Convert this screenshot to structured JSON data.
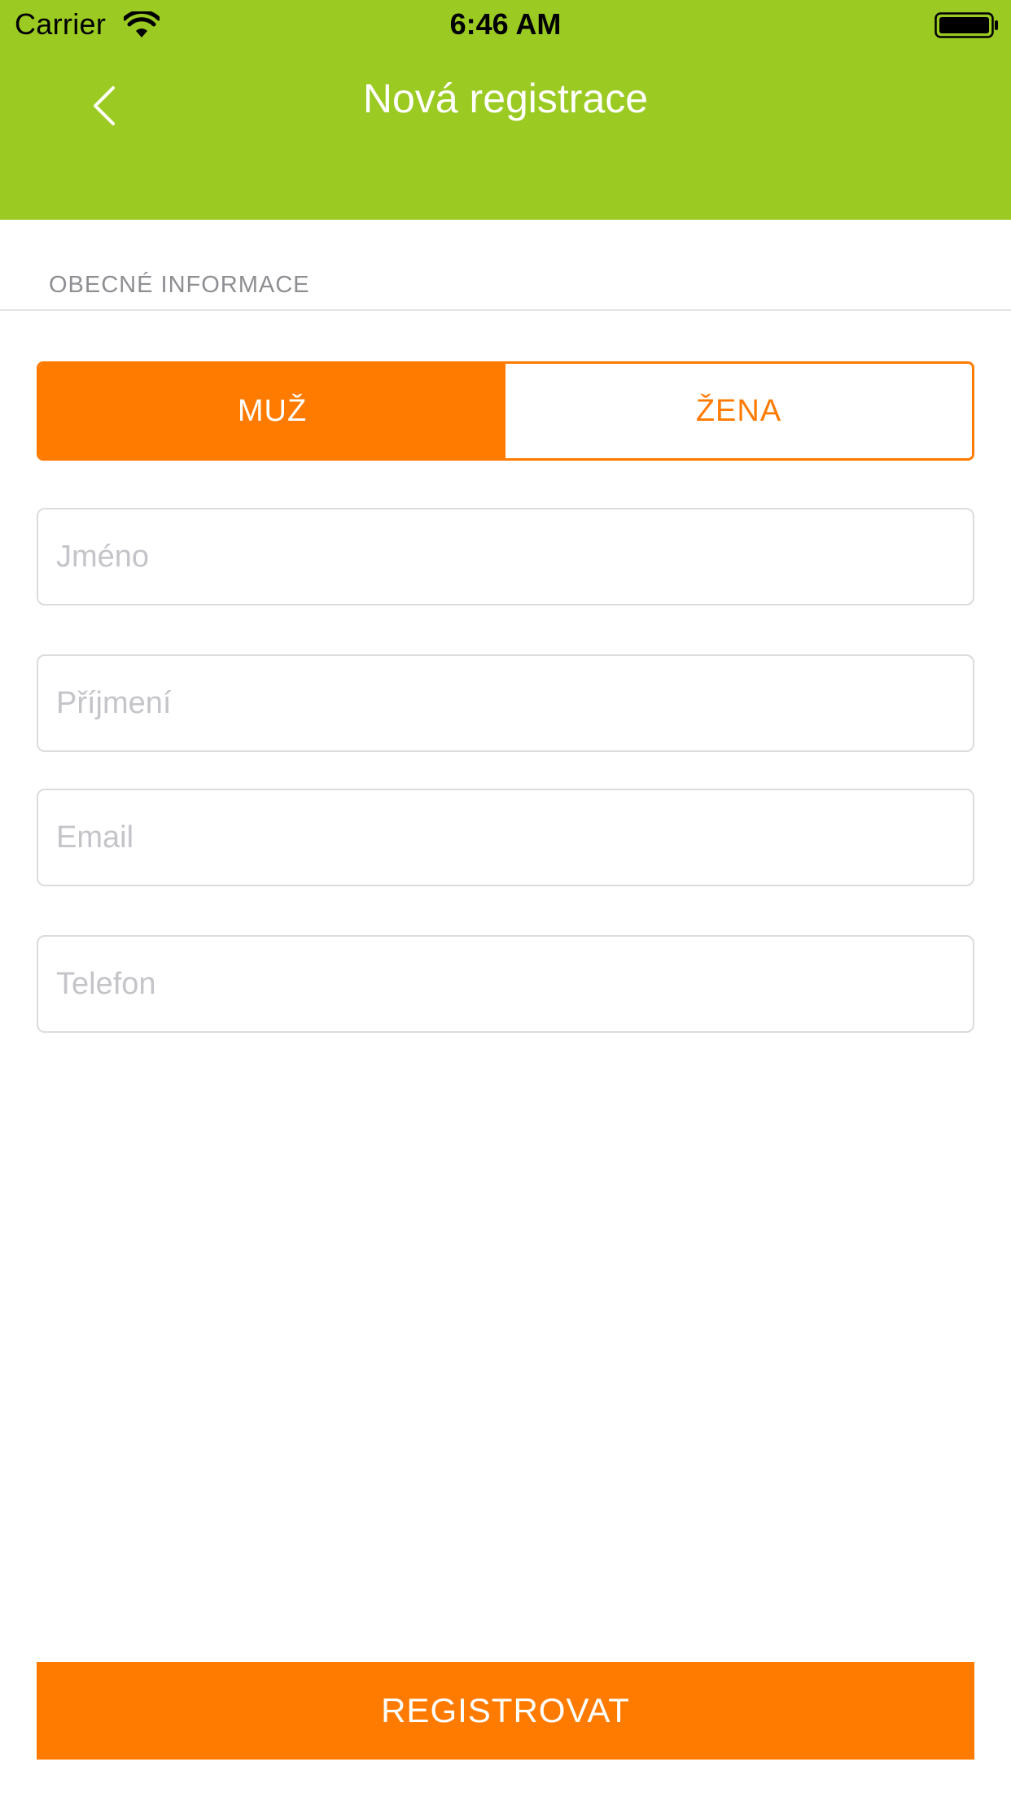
{
  "status_bar": {
    "carrier": "Carrier",
    "time": "6:46 AM"
  },
  "nav": {
    "title": "Nová registrace",
    "back_icon": "chevron-left-icon"
  },
  "section": {
    "title": "OBECNÉ INFORMACE"
  },
  "gender": {
    "options": [
      "MUŽ",
      "ŽENA"
    ],
    "selected": "MUŽ"
  },
  "form": {
    "first_name_placeholder": "Jméno",
    "last_name_placeholder": "Příjmení",
    "email_placeholder": "Email",
    "phone_placeholder": "Telefon"
  },
  "submit_label": "REGISTROVAT",
  "colors": {
    "header": "#9bca22",
    "accent": "#ff7b00"
  }
}
